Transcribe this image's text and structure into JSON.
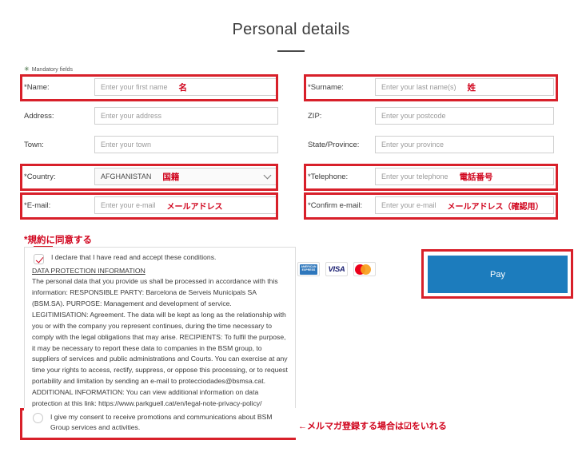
{
  "header": {
    "title": "Personal details"
  },
  "mandatory": {
    "star": "✳",
    "label": "Mandatory fields"
  },
  "form": {
    "left": [
      {
        "label": "*Name:",
        "placeholder": "Enter your first name",
        "note": "名",
        "type": "text",
        "highlighted": true
      },
      {
        "label": "Address:",
        "placeholder": "Enter your address",
        "note": "",
        "type": "text",
        "highlighted": false
      },
      {
        "label": "Town:",
        "placeholder": "Enter your town",
        "note": "",
        "type": "text",
        "highlighted": false
      },
      {
        "label": "*Country:",
        "value": "AFGHANISTAN",
        "note": "国籍",
        "type": "select",
        "highlighted": true
      },
      {
        "label": "*E-mail:",
        "placeholder": "Enter your e-mail",
        "note": "メールアドレス",
        "type": "text",
        "highlighted": true
      }
    ],
    "right": [
      {
        "label": "*Surname:",
        "placeholder": "Enter your last name(s)",
        "note": "姓",
        "type": "text",
        "highlighted": true
      },
      {
        "label": "ZIP:",
        "placeholder": "Enter your postcode",
        "note": "",
        "type": "text",
        "highlighted": false
      },
      {
        "label": "State/Province:",
        "placeholder": "Enter your province",
        "note": "",
        "type": "text",
        "highlighted": false
      },
      {
        "label": "*Telephone:",
        "placeholder": "Enter your telephone",
        "note": "電話番号",
        "type": "text",
        "highlighted": true
      },
      {
        "label": "*Confirm e-mail:",
        "placeholder": "Enter your e-mail",
        "note": "メールアドレス（確認用）",
        "type": "text",
        "highlighted": true
      }
    ]
  },
  "terms": {
    "heading": "*規約に同意する",
    "declare_label": "I declare that I have read and accept these conditions.",
    "declare_checked": true,
    "dpi_title": "DATA PROTECTION INFORMATION",
    "dpi_body": "The personal data that you provide us shall be processed in accordance with this information: RESPONSIBLE PARTY: Barcelona de Serveis Municipals SA (BSM.SA). PURPOSE: Management and development of service. LEGITIMISATION: Agreement. The data will be kept as long as the relationship with you or with the company you represent continues, during the time necessary to comply with the legal obligations that may arise. RECIPIENTS: To fulfil the purpose, it may be necessary to report these data to companies in the BSM group, to suppliers of services and public administrations and Courts. You can exercise at any time your rights to access, rectify, suppress, or oppose this processing, or to request portability and limitation by sending an e-mail to protecciodades@bsmsa.cat. ADDITIONAL INFORMATION: You can view additional information on data protection at this link: https://www.parkguell.cat/en/legal-note-privacy-policy/"
  },
  "consent": {
    "label": "I give my consent to receive promotions and communications about BSM Group services and activities.",
    "checked": false,
    "annotation": "←メルマガ登録する場合は☑をいれる"
  },
  "payment": {
    "cards": [
      {
        "name": "amex",
        "text": "AMERICAN\nEXPRESS"
      },
      {
        "name": "visa",
        "text": "VISA"
      },
      {
        "name": "mastercard",
        "text": ""
      }
    ],
    "pay_label": "Pay",
    "pay_color": "#1c7cbd"
  },
  "colors": {
    "highlight": "#d8202a",
    "annotation_text": "#d0021b",
    "pay_button": "#1c7cbd"
  }
}
